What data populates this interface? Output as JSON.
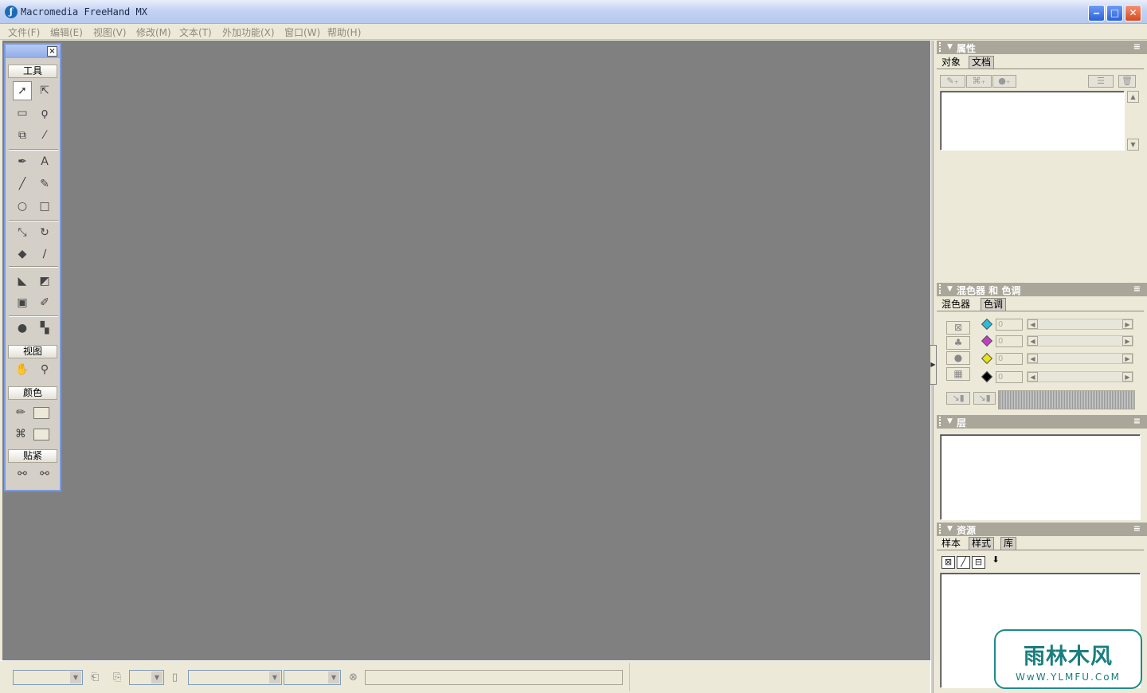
{
  "window": {
    "title": "Macromedia FreeHand MX",
    "minimize": "‒",
    "maximize": "□",
    "close": "✕"
  },
  "menu": [
    "文件(F)",
    "编辑(E)",
    "视图(V)",
    "修改(M)",
    "文本(T)",
    "外加功能(X)",
    "窗口(W)",
    "帮助(H)"
  ],
  "toolbox": {
    "close": "×",
    "sections": {
      "tools": "工具",
      "view": "视图",
      "color": "颜色",
      "snap": "贴紧"
    }
  },
  "panels": {
    "properties": {
      "title": "属性",
      "tabs": [
        "对象",
        "文档"
      ]
    },
    "mixer": {
      "title": "混色器 和 色调",
      "tabs": [
        "混色器",
        "色调"
      ],
      "channels": [
        "0",
        "0",
        "0",
        "0"
      ],
      "channel_colors": [
        "#2bbcd8",
        "#c23fc2",
        "#e6e21e",
        "#000000"
      ]
    },
    "layers": {
      "title": "层"
    },
    "assets": {
      "title": "资源",
      "tabs": [
        "样本",
        "样式",
        "库"
      ]
    },
    "options_icon": "≡"
  },
  "watermark": {
    "title": "雨林木风",
    "url": "WwW.YLMFU.CoM"
  }
}
